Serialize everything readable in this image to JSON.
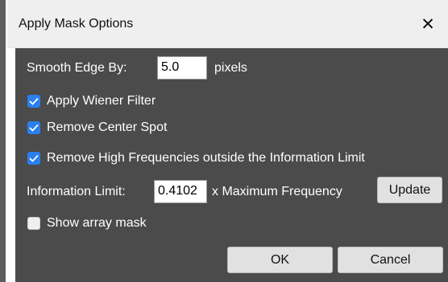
{
  "dialog": {
    "title": "Apply Mask Options",
    "close_symbol": "✕"
  },
  "smooth_edge": {
    "label": "Smooth Edge By:",
    "value": "5.0",
    "unit": "pixels"
  },
  "options": [
    {
      "label": "Apply Wiener Filter",
      "checked": true
    },
    {
      "label": "Remove Center Spot",
      "checked": true
    },
    {
      "label": "Remove High Frequencies outside the Information Limit",
      "checked": true
    }
  ],
  "information_limit": {
    "label": "Information Limit:",
    "value": "0.4102",
    "suffix": "x Maximum Frequency",
    "update_label": "Update"
  },
  "show_array_mask": {
    "label": "Show array mask",
    "checked": false
  },
  "buttons": {
    "ok_label": "OK",
    "cancel_label": "Cancel"
  },
  "colors": {
    "panel": "#4b4b4b",
    "checkbox_accent": "#2a7ff0",
    "titlebar": "#efefef"
  }
}
